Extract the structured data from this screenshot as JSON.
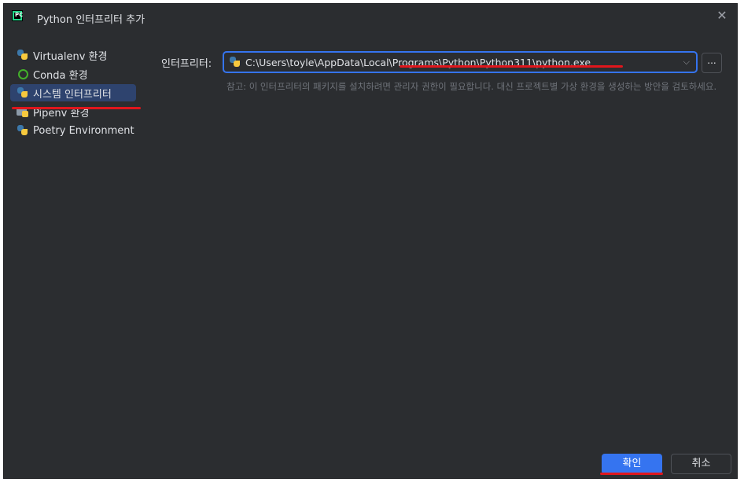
{
  "window": {
    "title": "Python 인터프리터 추가",
    "app_icon": "PC"
  },
  "sidebar": {
    "items": [
      {
        "label": "Virtualenv 환경",
        "icon": "python-icon"
      },
      {
        "label": "Conda 환경",
        "icon": "conda-icon"
      },
      {
        "label": "시스템 인터프리터",
        "icon": "python-icon",
        "selected": true
      },
      {
        "label": "Pipenv 환경",
        "icon": "pipenv-icon"
      },
      {
        "label": "Poetry Environment",
        "icon": "python-icon"
      }
    ]
  },
  "main": {
    "interpreter_label": "인터프리터:",
    "interpreter_value": "C:\\Users\\toyle\\AppData\\Local\\Programs\\Python\\Python311\\python.exe",
    "browse_label": "...",
    "note": "참고: 이 인터프리터의 패키지를 설치하려면 관리자 권한이 필요합니다. 대신 프로젝트별 가상 환경을 생성하는 방안을 검토하세요."
  },
  "footer": {
    "ok_label": "확인",
    "cancel_label": "취소"
  },
  "colors": {
    "background": "#2b2d30",
    "accent": "#3574f0",
    "selection": "#2e436e",
    "annotation": "#e0161c"
  }
}
